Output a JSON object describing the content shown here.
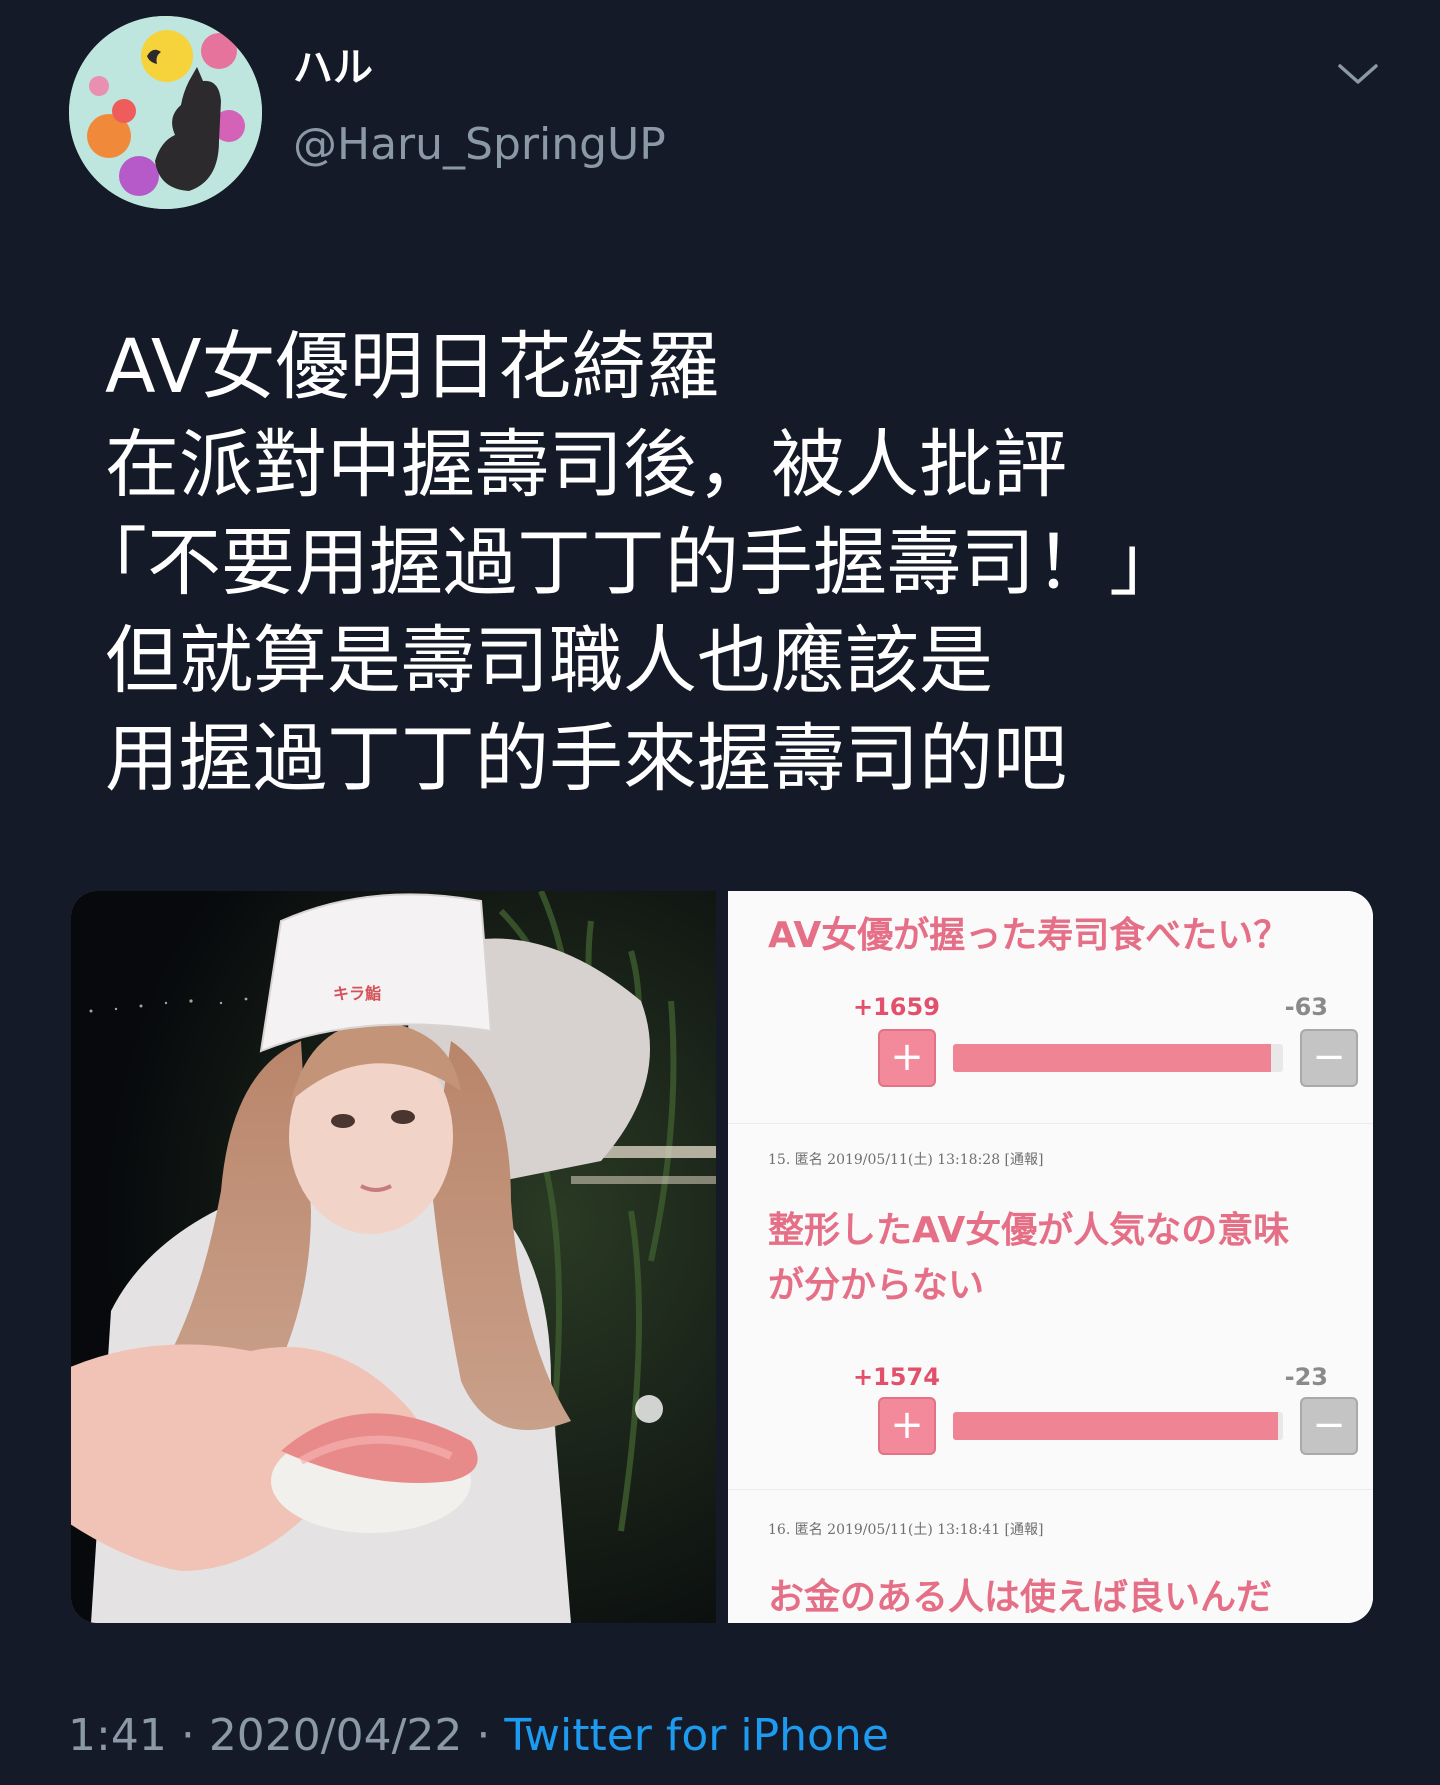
{
  "tweet": {
    "display_name": "ハル",
    "handle": "@Haru_SpringUP",
    "text_lines": [
      "AV女優明日花綺羅",
      "在派對中握壽司後，被人批評",
      "「不要用握過丁丁的手握壽司！」",
      "但就算是壽司職人也應該是",
      "用握過丁丁的手來握壽司的吧"
    ],
    "time": "1:41",
    "separator": "·",
    "date": "2020/04/22",
    "source": "Twitter for iPhone"
  },
  "icons": {
    "menu": "chevron-down-icon",
    "avatar": "cat-silhouette-avatar"
  },
  "media": {
    "photo_alt": "woman in sushi chef uniform holding out sushi",
    "hat_logo": "キラ鮨",
    "comments": [
      {
        "question": "AV女優が握った寿司食べたい？",
        "plus": "+1659",
        "minus": "-63",
        "plus_fraction": 0.963
      },
      {
        "meta": "15. 匿名 2019/05/11(土) 13:18:28 [通報]",
        "body_lines": [
          "整形したAV女優が人気なの意味",
          "が分からない"
        ],
        "plus": "+1574",
        "minus": "-23",
        "plus_fraction": 0.986
      },
      {
        "meta": "16. 匿名 2019/05/11(土) 13:18:41 [通報]",
        "body_lines": [
          "お金のある人は使えば良いんだ"
        ]
      }
    ],
    "plus_symbol": "+",
    "minus_symbol": "−"
  },
  "colors": {
    "background": "#151a28",
    "link": "#1d9bf0",
    "muted": "#8b98a5",
    "accent_pink": "#e56f86"
  }
}
